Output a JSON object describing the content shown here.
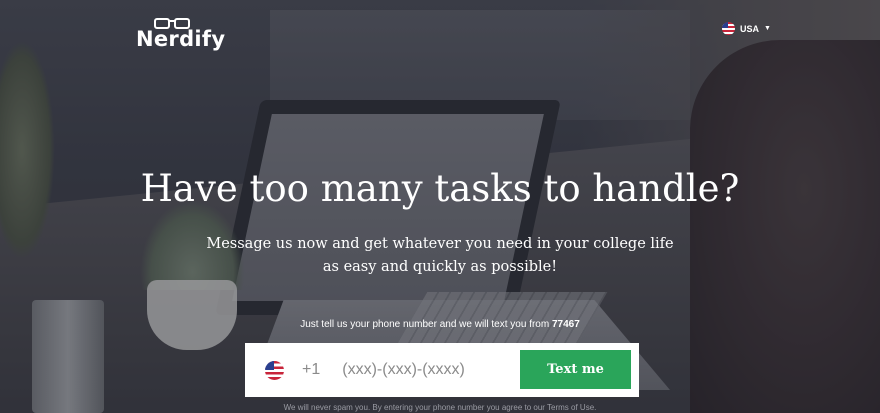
{
  "header": {
    "logo_text": "Nerdify",
    "country_label": "USA"
  },
  "hero": {
    "headline": "Have too many tasks to handle?",
    "subline_1": "Message us now and get whatever you need in your college life",
    "subline_2": "as easy and quickly as possible!",
    "hint_prefix": "Just tell us your phone number and we will text you from",
    "hint_number": "77467"
  },
  "form": {
    "country_code": "+1",
    "phone_placeholder": "(xxx)-(xxx)-(xxxx)",
    "phone_value": "",
    "submit_label": "Text me"
  },
  "footer": {
    "disclaimer": "We will never spam you. By entering your phone number you agree to our Terms of Use."
  },
  "colors": {
    "accent": "#2aa55a",
    "text_on_dark": "#ffffff"
  },
  "icons": {
    "logo_mark": "glasses-icon",
    "country_flag": "us-flag-icon",
    "dropdown": "caret-down-icon"
  }
}
